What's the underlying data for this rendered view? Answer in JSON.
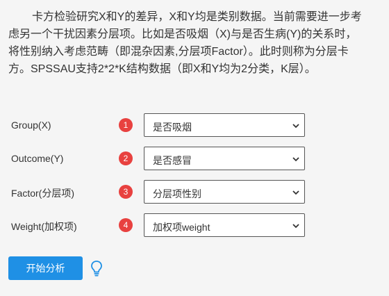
{
  "intro": {
    "text": "卡方检验研究X和Y的差异，X和Y均是类别数据。当前需要进一步考虑另一个干扰因素分层项。比如是否吸烟（X)与是否生病(Y)的关系时，将性别纳入考虑范畴（即混杂因素,分层项Factor）。此时则称为分层卡方。SPSSAU支持2*2*K结构数据（即X和Y均为2分类，K层）。"
  },
  "form": {
    "rows": [
      {
        "label": "Group(X)",
        "badge": "1",
        "selected": "是否吸烟"
      },
      {
        "label": "Outcome(Y)",
        "badge": "2",
        "selected": "是否感冒"
      },
      {
        "label": "Factor(分层项)",
        "badge": "3",
        "selected": "分层项性别"
      },
      {
        "label": "Weight(加权项)",
        "badge": "4",
        "selected": "加权项weight"
      }
    ]
  },
  "actions": {
    "start_label": "开始分析",
    "hint_icon": "lightbulb-icon"
  },
  "colors": {
    "badge": "#e8413f",
    "primary_button": "#1f90e5",
    "hint_icon": "#1f90e5",
    "background": "#f5f5f5"
  }
}
